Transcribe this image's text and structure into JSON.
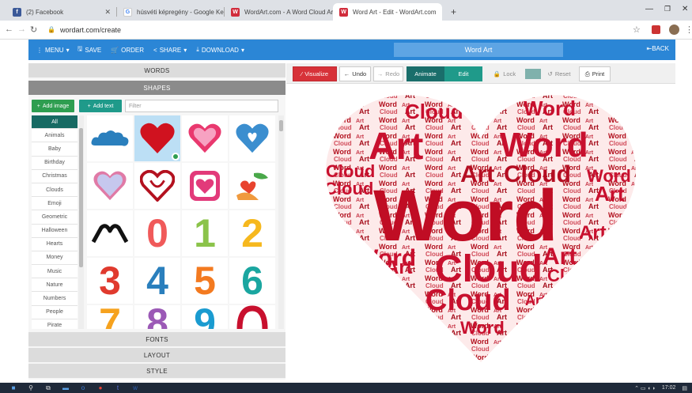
{
  "browser": {
    "tabs": [
      {
        "title": "(2) Facebook",
        "icon": "facebook-icon",
        "color": "#3b5998",
        "glyph": "f"
      },
      {
        "title": "húsvéti képregény - Google Kere",
        "icon": "google-icon",
        "color": "#ffffff",
        "glyph": "G"
      },
      {
        "title": "WordArt.com - A Word Cloud Art",
        "icon": "wordart-icon",
        "color": "#d12c3c",
        "glyph": "W"
      },
      {
        "title": "Word Art - Edit - WordArt.com",
        "icon": "wordart-icon",
        "color": "#d12c3c",
        "glyph": "W"
      }
    ],
    "new_tab": "+",
    "url": "wordart.com/create"
  },
  "toolbar": {
    "menu": "MENU",
    "save": "SAVE",
    "order": "ORDER",
    "share": "SHARE",
    "download": "DOWNLOAD",
    "title": "Word Art",
    "back": "BACK"
  },
  "left": {
    "words_label": "WORDS",
    "shapes_label": "SHAPES",
    "add_image": "Add image",
    "add_text": "Add text",
    "filter_placeholder": "Filter",
    "categories": [
      "All",
      "Animals",
      "Baby",
      "Birthday",
      "Christmas",
      "Clouds",
      "Emoji",
      "Geometric",
      "Halloween",
      "Hearts",
      "Money",
      "Music",
      "Nature",
      "Numbers",
      "People",
      "Pirate"
    ],
    "fonts_label": "FONTS",
    "layout_label": "LAYOUT",
    "style_label": "STYLE",
    "shape_names": [
      "cloud-shape",
      "heart-shape-selected",
      "heart-pink-shape",
      "heart-blue-shape",
      "heart-outline-shape",
      "heart-arrow-shape",
      "heart-square-shape",
      "hands-heart-shape",
      "hands-heart-black-shape",
      "digit-zero-shape",
      "digit-one-shape",
      "digit-two-shape",
      "digit-three-shape",
      "digit-four-shape",
      "digit-five-shape",
      "digit-six-shape",
      "digit-seven-shape",
      "digit-eight-shape",
      "digit-nine-shape",
      "red-swirl-shape"
    ]
  },
  "editor": {
    "visualize": "Visualize",
    "undo": "Undo",
    "redo": "Redo",
    "animate": "Animate",
    "edit": "Edit",
    "lock": "Lock",
    "reset": "Reset",
    "print": "Print"
  },
  "cloud_words": {
    "big": "Word",
    "art": "Art",
    "cloud": "Cloud"
  },
  "taskbar": {
    "time": "17:02"
  },
  "colors": {
    "accent": "#2b86d6",
    "wordart_red": "#c8102e",
    "green": "#2e9e50",
    "teal": "#1f9a8a",
    "visualize": "#d73239"
  }
}
